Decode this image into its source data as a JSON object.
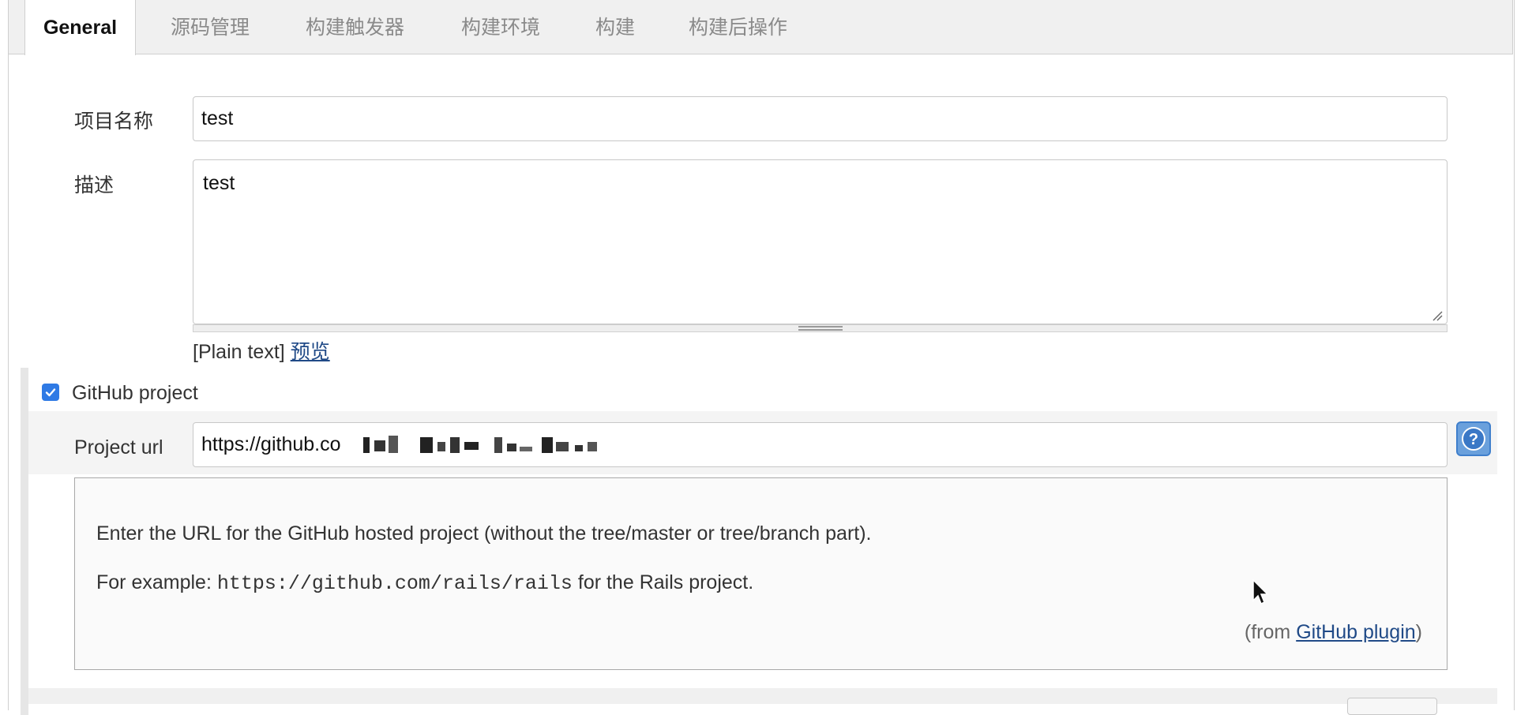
{
  "tabs": [
    {
      "label": "General",
      "active": true
    },
    {
      "label": "源码管理",
      "active": false
    },
    {
      "label": "构建触发器",
      "active": false
    },
    {
      "label": "构建环境",
      "active": false
    },
    {
      "label": "构建",
      "active": false
    },
    {
      "label": "构建后操作",
      "active": false
    }
  ],
  "general": {
    "project_name_label": "项目名称",
    "project_name_value": "test",
    "description_label": "描述",
    "description_value": "test",
    "description_format": "[Plain text]",
    "preview_link": "预览"
  },
  "github_project": {
    "checkbox_label": "GitHub project",
    "checked": true,
    "project_url_label": "Project url",
    "project_url_value": "https://github.co"
  },
  "help": {
    "line1": "Enter the URL for the GitHub hosted project (without the tree/master or tree/branch part).",
    "line2_prefix": "For example: ",
    "line2_code": "https://github.com/rails/rails",
    "line2_suffix": " for the Rails project.",
    "from_prefix": "(from ",
    "from_link": "GitHub plugin",
    "from_suffix": ")"
  },
  "colors": {
    "checkbox_blue": "#2f7ae5",
    "link_blue": "#204a87",
    "help_icon_blue": "#6aa0dc"
  },
  "icons": [
    "check-icon",
    "help-icon",
    "resize-grip-icon",
    "mouse-cursor-icon"
  ]
}
